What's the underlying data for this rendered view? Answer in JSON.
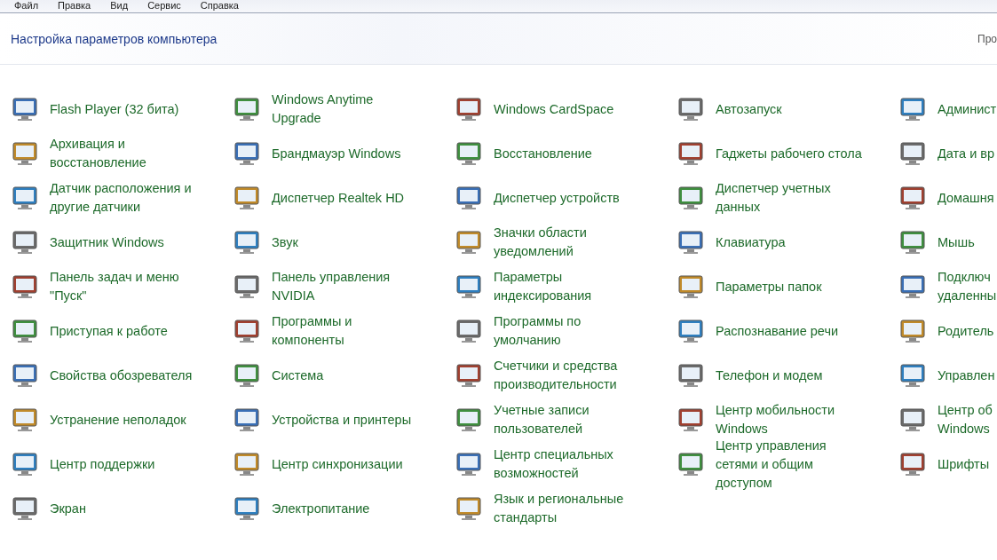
{
  "menu": [
    "Файл",
    "Правка",
    "Вид",
    "Сервис",
    "Справка"
  ],
  "header": {
    "title": "Настройка параметров компьютера",
    "view_label": "Про"
  },
  "items": [
    {
      "label": "Flash Player (32 бита)"
    },
    {
      "label": "Windows Anytime Upgrade"
    },
    {
      "label": "Windows CardSpace"
    },
    {
      "label": "Автозапуск"
    },
    {
      "label": "Админист"
    },
    {
      "label": "Архивация и восстановление"
    },
    {
      "label": "Брандмауэр Windows"
    },
    {
      "label": "Восстановление"
    },
    {
      "label": "Гаджеты рабочего стола"
    },
    {
      "label": "Дата и вр"
    },
    {
      "label": "Датчик расположения и другие датчики"
    },
    {
      "label": "Диспетчер Realtek HD"
    },
    {
      "label": "Диспетчер устройств"
    },
    {
      "label": "Диспетчер учетных данных"
    },
    {
      "label": "Домашня"
    },
    {
      "label": "Защитник Windows"
    },
    {
      "label": "Звук"
    },
    {
      "label": "Значки области уведомлений"
    },
    {
      "label": "Клавиатура"
    },
    {
      "label": "Мышь"
    },
    {
      "label": "Панель задач и меню \"Пуск\""
    },
    {
      "label": "Панель управления NVIDIA"
    },
    {
      "label": "Параметры индексирования"
    },
    {
      "label": "Параметры папок"
    },
    {
      "label": "Подключ\nудаленны"
    },
    {
      "label": "Приступая к работе"
    },
    {
      "label": "Программы и компоненты"
    },
    {
      "label": "Программы по умолчанию"
    },
    {
      "label": "Распознавание речи"
    },
    {
      "label": "Родитель"
    },
    {
      "label": "Свойства обозревателя"
    },
    {
      "label": "Система"
    },
    {
      "label": "Счетчики и средства производительности"
    },
    {
      "label": "Телефон и модем"
    },
    {
      "label": "Управлен"
    },
    {
      "label": "Устранение неполадок"
    },
    {
      "label": "Устройства и принтеры"
    },
    {
      "label": "Учетные записи пользователей"
    },
    {
      "label": "Центр мобильности Windows"
    },
    {
      "label": "Центр об\nWindows"
    },
    {
      "label": "Центр поддержки"
    },
    {
      "label": "Центр синхронизации"
    },
    {
      "label": "Центр специальных возможностей"
    },
    {
      "label": "Центр управления сетями и общим доступом"
    },
    {
      "label": "Шрифты"
    },
    {
      "label": "Экран"
    },
    {
      "label": "Электропитание"
    },
    {
      "label": "Язык и региональные стандарты"
    }
  ]
}
